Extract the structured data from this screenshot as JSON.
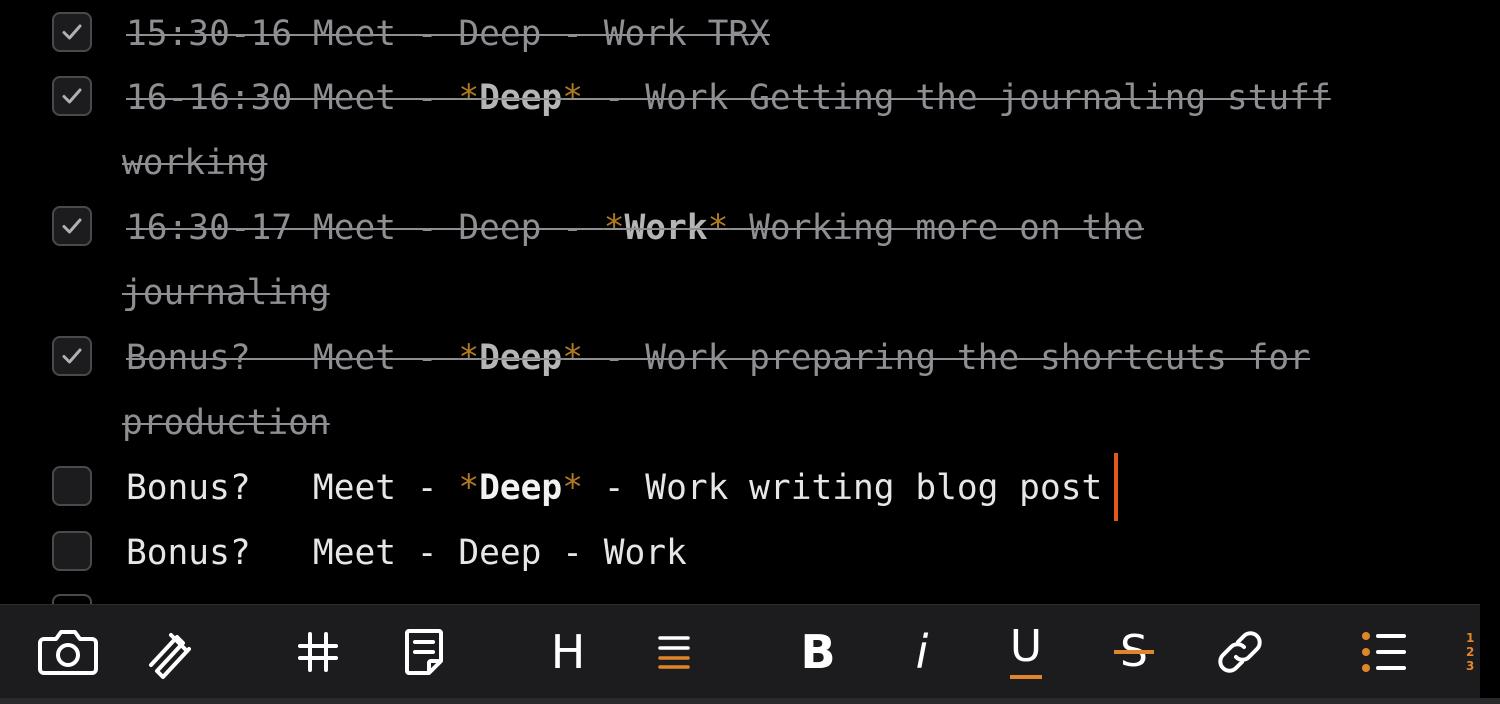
{
  "tasks": [
    {
      "done": true,
      "lines": [
        [
          {
            "t": "15:30-16 Meet - Deep - Work TRX"
          }
        ]
      ]
    },
    {
      "done": true,
      "lines": [
        [
          {
            "t": "16-16:30 Meet - "
          },
          {
            "t": "*",
            "s": "star"
          },
          {
            "t": "Deep",
            "s": "bold"
          },
          {
            "t": "*",
            "s": "star"
          },
          {
            "t": " - Work Getting the journaling stuff"
          }
        ],
        [
          {
            "t": "working"
          }
        ]
      ]
    },
    {
      "done": true,
      "lines": [
        [
          {
            "t": "16:30-17 Meet - Deep - "
          },
          {
            "t": "*",
            "s": "star"
          },
          {
            "t": "Work",
            "s": "bold"
          },
          {
            "t": "*",
            "s": "star"
          },
          {
            "t": " Working more on the"
          }
        ],
        [
          {
            "t": "journaling"
          }
        ]
      ]
    },
    {
      "done": true,
      "lines": [
        [
          {
            "t": "Bonus?   Meet - "
          },
          {
            "t": "*",
            "s": "star"
          },
          {
            "t": "Deep",
            "s": "bold"
          },
          {
            "t": "*",
            "s": "star"
          },
          {
            "t": " - Work preparing the shortcuts for"
          }
        ],
        [
          {
            "t": "production"
          }
        ]
      ]
    },
    {
      "done": false,
      "lines": [
        [
          {
            "t": "Bonus?   Meet - "
          },
          {
            "t": "*",
            "s": "star"
          },
          {
            "t": "Deep",
            "s": "bold"
          },
          {
            "t": "*",
            "s": "star"
          },
          {
            "t": " - Work writing blog post"
          }
        ]
      ]
    },
    {
      "done": false,
      "lines": [
        [
          {
            "t": "Bonus?   Meet - Deep - Work"
          }
        ]
      ]
    }
  ],
  "toolbar": {
    "items": [
      {
        "name": "camera-icon"
      },
      {
        "name": "scribble-icon"
      },
      {
        "name": "table-icon"
      },
      {
        "name": "note-icon"
      },
      {
        "name": "heading-button",
        "label": "H"
      },
      {
        "name": "align-icon"
      },
      {
        "name": "bold-button",
        "label": "B"
      },
      {
        "name": "italic-button",
        "label": "i"
      },
      {
        "name": "underline-button",
        "label": "U"
      },
      {
        "name": "strikethrough-button",
        "label": "S"
      },
      {
        "name": "link-icon"
      },
      {
        "name": "bullet-list-icon"
      }
    ],
    "ordered_list": [
      "1",
      "2",
      "3"
    ]
  },
  "colors": {
    "background": "#000000",
    "accent": "#e0862a",
    "cursor": "#e05a1e",
    "star": "#b07a22"
  }
}
